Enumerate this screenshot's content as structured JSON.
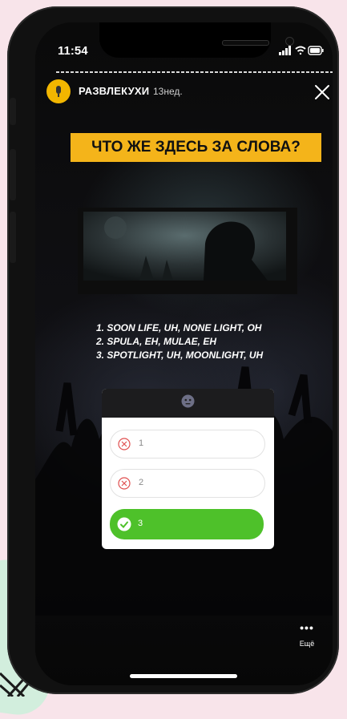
{
  "status_bar": {
    "time": "11:54"
  },
  "story": {
    "username": "РАЗВЛЕКУХИ",
    "posted_ago": "13нед."
  },
  "content": {
    "title": "ЧТО ЖЕ ЗДЕСЬ ЗА СЛОВА?",
    "lyrics": [
      "1. SOON LIFE, UH, NONE LIGHT, OH",
      "2. SPULA, EH, MULAE, EH",
      "3. SPOTLIGHT, UH, MOONLIGHT, UH"
    ]
  },
  "quiz": {
    "options": [
      {
        "label": "1",
        "state": "wrong"
      },
      {
        "label": "2",
        "state": "wrong"
      },
      {
        "label": "3",
        "state": "correct"
      }
    ]
  },
  "more": {
    "label": "Ещё"
  },
  "icons": {
    "close": "close-icon",
    "more": "more-dots-icon",
    "wrong": "x-circle-icon",
    "correct": "check-circle-icon"
  },
  "colors": {
    "banner": "#f4b41a",
    "correct": "#4ec12a",
    "wrong": "#e05050"
  }
}
